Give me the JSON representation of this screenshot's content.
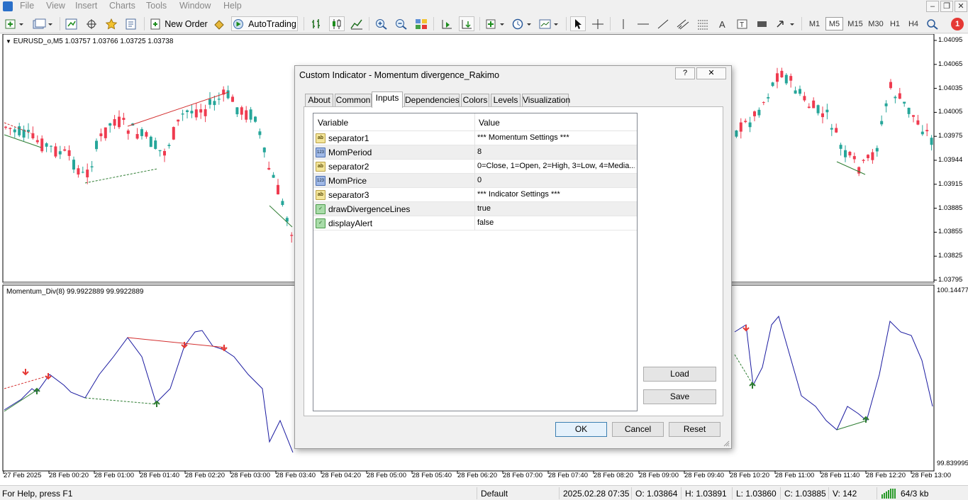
{
  "menu": [
    "File",
    "View",
    "Insert",
    "Charts",
    "Tools",
    "Window",
    "Help"
  ],
  "toolbar": {
    "new_order": "New Order",
    "autotrading": "AutoTrading",
    "timeframes": [
      "M1",
      "M5",
      "M15",
      "M30",
      "H1",
      "H4"
    ],
    "active_timeframe": "M5",
    "notification_count": "1"
  },
  "chart": {
    "main_title": "EURUSD_o,M5  1.03757 1.03766 1.03725 1.03738",
    "indicator_title": "Momentum_Div(8) 99.9922889 99.9922889",
    "price_labels": [
      "1.04095",
      "1.04065",
      "1.04035",
      "1.04005",
      "1.03975",
      "1.03944",
      "1.03915",
      "1.03885",
      "1.03855",
      "1.03825",
      "1.03795"
    ],
    "indicator_labels": [
      "100.14477",
      "99.839995"
    ],
    "time_labels": [
      "27 Feb 2025",
      "28 Feb 00:20",
      "28 Feb 01:00",
      "28 Feb 01:40",
      "28 Feb 02:20",
      "28 Feb 03:00",
      "28 Feb 03:40",
      "28 Feb 04:20",
      "28 Feb 05:00",
      "28 Feb 05:40",
      "28 Feb 06:20",
      "28 Feb 07:00",
      "28 Feb 07:40",
      "28 Feb 08:20",
      "28 Feb 09:00",
      "28 Feb 09:40",
      "28 Feb 10:20",
      "28 Feb 11:00",
      "28 Feb 11:40",
      "28 Feb 12:20",
      "28 Feb 13:00"
    ],
    "bull_color": "#26a69a",
    "bear_color": "#ef3b4f",
    "momentum_color": "#1a1aa0"
  },
  "dialog": {
    "title": "Custom Indicator - Momentum divergence_Rakimo",
    "help": "?",
    "close": "✕",
    "tabs": [
      "About",
      "Common",
      "Inputs",
      "Dependencies",
      "Colors",
      "Levels",
      "Visualization"
    ],
    "active_tab": "Inputs",
    "columns": [
      "Variable",
      "Value"
    ],
    "inputs": [
      {
        "type": "ab",
        "variable": "separator1",
        "value": "*** Momentum Settings ***"
      },
      {
        "type": "123",
        "variable": "MomPeriod",
        "value": "8"
      },
      {
        "type": "ab",
        "variable": "separator2",
        "value": "0=Close, 1=Open, 2=High, 3=Low, 4=Media..."
      },
      {
        "type": "123",
        "variable": "MomPrice",
        "value": "0"
      },
      {
        "type": "ab",
        "variable": "separator3",
        "value": "*** Indicator Settings ***"
      },
      {
        "type": "bool",
        "variable": "drawDivergenceLines",
        "value": "true"
      },
      {
        "type": "bool",
        "variable": "displayAlert",
        "value": "false"
      }
    ],
    "load": "Load",
    "save": "Save",
    "ok": "OK",
    "cancel": "Cancel",
    "reset": "Reset"
  },
  "status": {
    "help": "For Help, press F1",
    "profile": "Default",
    "datetime": "2025.02.28 07:35",
    "open": "O: 1.03864",
    "high": "H: 1.03891",
    "low": "L: 1.03860",
    "close": "C: 1.03885",
    "volume": "V: 142",
    "traffic": "64/3 kb"
  }
}
